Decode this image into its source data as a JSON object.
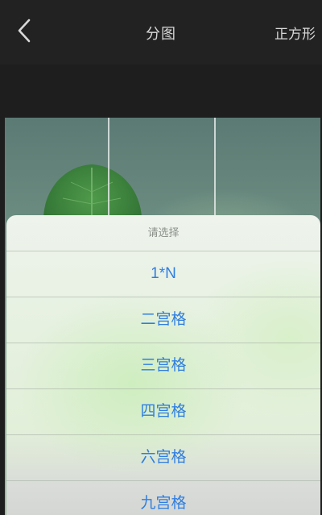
{
  "header": {
    "title": "分图",
    "right_action": "正方形",
    "back_icon": "chevron-left-icon"
  },
  "action_sheet": {
    "title": "请选择",
    "options": [
      {
        "label": "1*N"
      },
      {
        "label": "二宫格"
      },
      {
        "label": "三宫格"
      },
      {
        "label": "四宫格"
      },
      {
        "label": "六宫格"
      },
      {
        "label": "九宫格"
      }
    ]
  },
  "colors": {
    "option_text": "#2f7ee0",
    "nav_bg": "#222222"
  }
}
